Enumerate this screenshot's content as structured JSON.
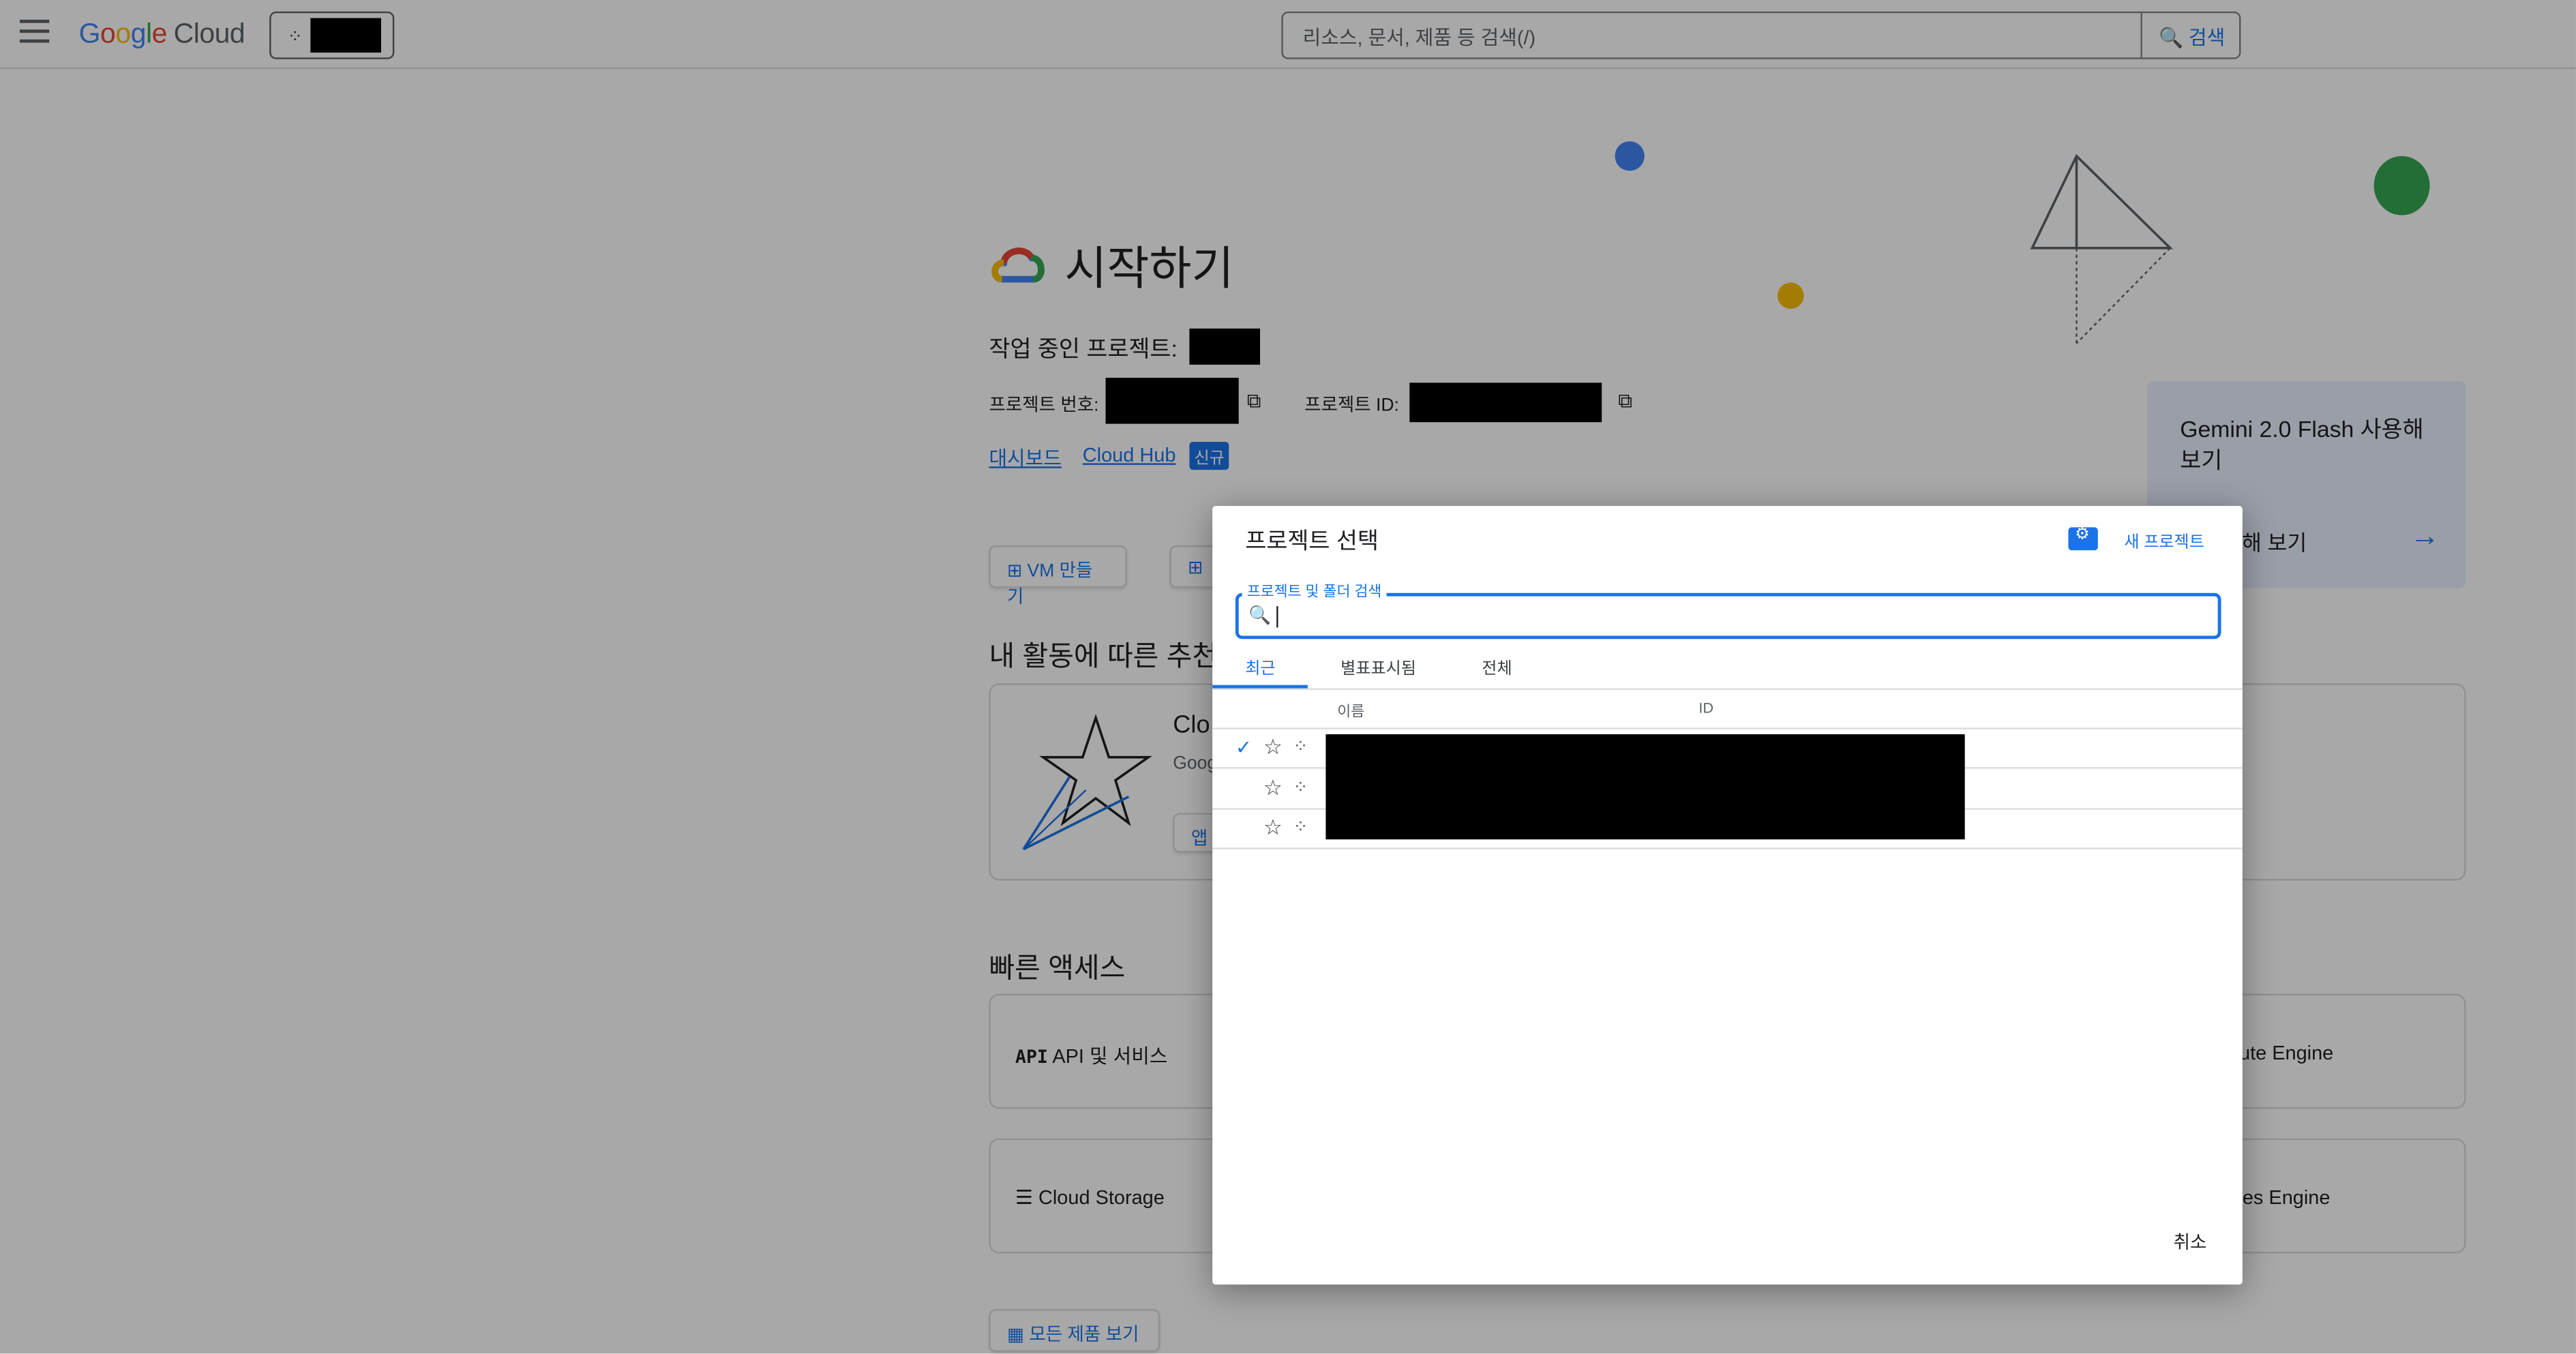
{
  "topbar": {
    "logo_letters": [
      "G",
      "o",
      "o",
      "g",
      "l",
      "e"
    ],
    "logo_cloud": "Cloud",
    "search_placeholder": "리소스, 문서, 제품 등 검색(/)",
    "search_button": "검색"
  },
  "hero": {
    "title": "시작하기",
    "working_project_label": "작업 중인 프로젝트:",
    "project_number_label": "프로젝트 번호:",
    "project_id_label": "프로젝트 ID:",
    "dashboard_link": "대시보드",
    "cloud_hub_link": "Cloud Hub",
    "new_badge": "신규"
  },
  "actions": {
    "vm_button": "VM 만들기"
  },
  "sections": {
    "recommend_title": "내 활동에 따른 추천",
    "recommend_card_title": "Clo",
    "recommend_card_sub": "Goog",
    "recommend_card_btn": "앱",
    "quick_access_title": "빠른 액세스",
    "quick_items": [
      "API 및 서비스",
      "Cloud Storage"
    ],
    "quick_items_right": [
      "ute Engine",
      "etes Engine"
    ],
    "all_products": "모든 제품 보기"
  },
  "promo": {
    "title": "Gemini 2.0 Flash 사용해 보기",
    "cta": "ni 사용해 보기"
  },
  "modal": {
    "title": "프로젝트 선택",
    "new_project": "새 프로젝트",
    "search_label": "프로젝트 및 폴더 검색",
    "tabs": [
      "최근",
      "별표표시됨",
      "전체"
    ],
    "col_name": "이름",
    "col_id": "ID",
    "cancel": "취소"
  },
  "colors": {
    "accent": "#1a73e8",
    "overlay": "rgba(0,0,0,0.34)"
  }
}
